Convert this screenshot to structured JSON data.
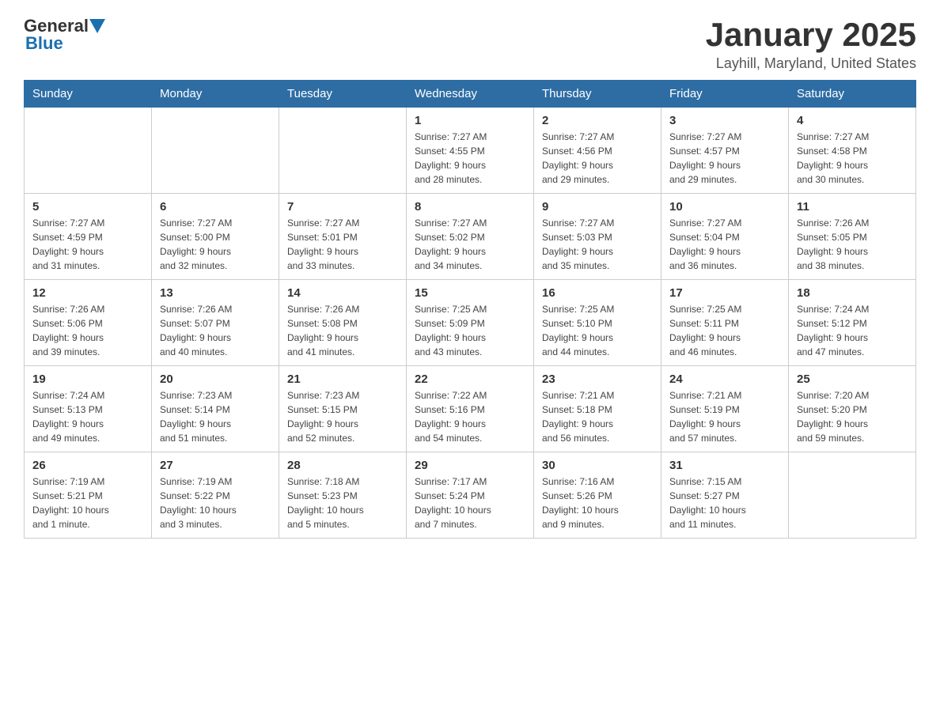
{
  "header": {
    "logo_general": "General",
    "logo_blue": "Blue",
    "title": "January 2025",
    "subtitle": "Layhill, Maryland, United States"
  },
  "weekdays": [
    "Sunday",
    "Monday",
    "Tuesday",
    "Wednesday",
    "Thursday",
    "Friday",
    "Saturday"
  ],
  "weeks": [
    [
      {
        "day": "",
        "info": ""
      },
      {
        "day": "",
        "info": ""
      },
      {
        "day": "",
        "info": ""
      },
      {
        "day": "1",
        "info": "Sunrise: 7:27 AM\nSunset: 4:55 PM\nDaylight: 9 hours\nand 28 minutes."
      },
      {
        "day": "2",
        "info": "Sunrise: 7:27 AM\nSunset: 4:56 PM\nDaylight: 9 hours\nand 29 minutes."
      },
      {
        "day": "3",
        "info": "Sunrise: 7:27 AM\nSunset: 4:57 PM\nDaylight: 9 hours\nand 29 minutes."
      },
      {
        "day": "4",
        "info": "Sunrise: 7:27 AM\nSunset: 4:58 PM\nDaylight: 9 hours\nand 30 minutes."
      }
    ],
    [
      {
        "day": "5",
        "info": "Sunrise: 7:27 AM\nSunset: 4:59 PM\nDaylight: 9 hours\nand 31 minutes."
      },
      {
        "day": "6",
        "info": "Sunrise: 7:27 AM\nSunset: 5:00 PM\nDaylight: 9 hours\nand 32 minutes."
      },
      {
        "day": "7",
        "info": "Sunrise: 7:27 AM\nSunset: 5:01 PM\nDaylight: 9 hours\nand 33 minutes."
      },
      {
        "day": "8",
        "info": "Sunrise: 7:27 AM\nSunset: 5:02 PM\nDaylight: 9 hours\nand 34 minutes."
      },
      {
        "day": "9",
        "info": "Sunrise: 7:27 AM\nSunset: 5:03 PM\nDaylight: 9 hours\nand 35 minutes."
      },
      {
        "day": "10",
        "info": "Sunrise: 7:27 AM\nSunset: 5:04 PM\nDaylight: 9 hours\nand 36 minutes."
      },
      {
        "day": "11",
        "info": "Sunrise: 7:26 AM\nSunset: 5:05 PM\nDaylight: 9 hours\nand 38 minutes."
      }
    ],
    [
      {
        "day": "12",
        "info": "Sunrise: 7:26 AM\nSunset: 5:06 PM\nDaylight: 9 hours\nand 39 minutes."
      },
      {
        "day": "13",
        "info": "Sunrise: 7:26 AM\nSunset: 5:07 PM\nDaylight: 9 hours\nand 40 minutes."
      },
      {
        "day": "14",
        "info": "Sunrise: 7:26 AM\nSunset: 5:08 PM\nDaylight: 9 hours\nand 41 minutes."
      },
      {
        "day": "15",
        "info": "Sunrise: 7:25 AM\nSunset: 5:09 PM\nDaylight: 9 hours\nand 43 minutes."
      },
      {
        "day": "16",
        "info": "Sunrise: 7:25 AM\nSunset: 5:10 PM\nDaylight: 9 hours\nand 44 minutes."
      },
      {
        "day": "17",
        "info": "Sunrise: 7:25 AM\nSunset: 5:11 PM\nDaylight: 9 hours\nand 46 minutes."
      },
      {
        "day": "18",
        "info": "Sunrise: 7:24 AM\nSunset: 5:12 PM\nDaylight: 9 hours\nand 47 minutes."
      }
    ],
    [
      {
        "day": "19",
        "info": "Sunrise: 7:24 AM\nSunset: 5:13 PM\nDaylight: 9 hours\nand 49 minutes."
      },
      {
        "day": "20",
        "info": "Sunrise: 7:23 AM\nSunset: 5:14 PM\nDaylight: 9 hours\nand 51 minutes."
      },
      {
        "day": "21",
        "info": "Sunrise: 7:23 AM\nSunset: 5:15 PM\nDaylight: 9 hours\nand 52 minutes."
      },
      {
        "day": "22",
        "info": "Sunrise: 7:22 AM\nSunset: 5:16 PM\nDaylight: 9 hours\nand 54 minutes."
      },
      {
        "day": "23",
        "info": "Sunrise: 7:21 AM\nSunset: 5:18 PM\nDaylight: 9 hours\nand 56 minutes."
      },
      {
        "day": "24",
        "info": "Sunrise: 7:21 AM\nSunset: 5:19 PM\nDaylight: 9 hours\nand 57 minutes."
      },
      {
        "day": "25",
        "info": "Sunrise: 7:20 AM\nSunset: 5:20 PM\nDaylight: 9 hours\nand 59 minutes."
      }
    ],
    [
      {
        "day": "26",
        "info": "Sunrise: 7:19 AM\nSunset: 5:21 PM\nDaylight: 10 hours\nand 1 minute."
      },
      {
        "day": "27",
        "info": "Sunrise: 7:19 AM\nSunset: 5:22 PM\nDaylight: 10 hours\nand 3 minutes."
      },
      {
        "day": "28",
        "info": "Sunrise: 7:18 AM\nSunset: 5:23 PM\nDaylight: 10 hours\nand 5 minutes."
      },
      {
        "day": "29",
        "info": "Sunrise: 7:17 AM\nSunset: 5:24 PM\nDaylight: 10 hours\nand 7 minutes."
      },
      {
        "day": "30",
        "info": "Sunrise: 7:16 AM\nSunset: 5:26 PM\nDaylight: 10 hours\nand 9 minutes."
      },
      {
        "day": "31",
        "info": "Sunrise: 7:15 AM\nSunset: 5:27 PM\nDaylight: 10 hours\nand 11 minutes."
      },
      {
        "day": "",
        "info": ""
      }
    ]
  ]
}
